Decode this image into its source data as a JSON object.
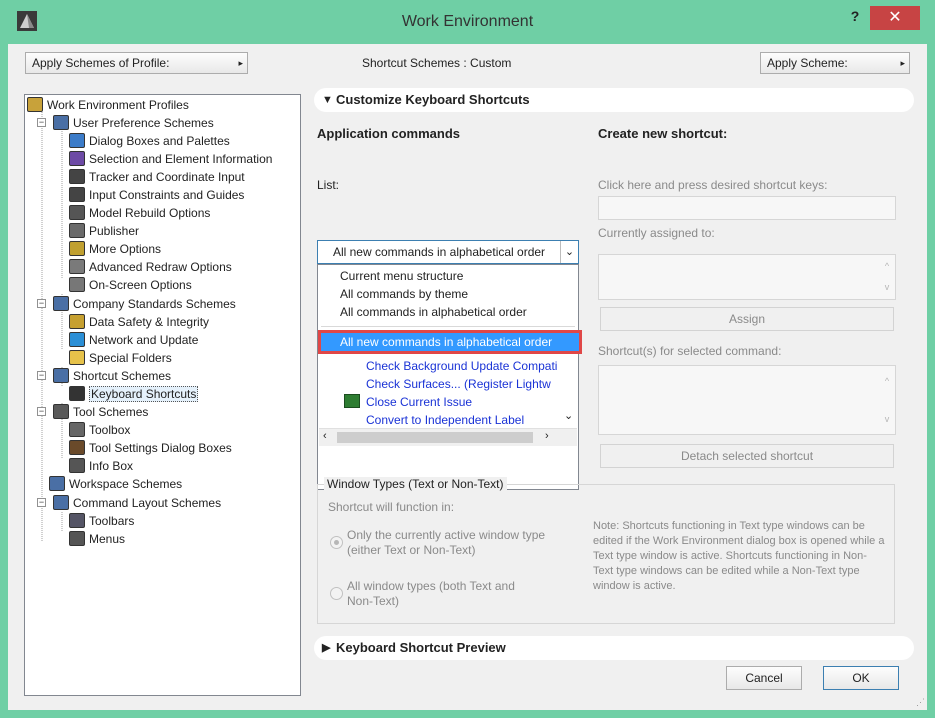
{
  "window": {
    "title": "Work Environment",
    "help_label": "?",
    "close_label": "✕"
  },
  "top": {
    "apply_profile_label": "Apply Schemes of Profile:",
    "shortcut_schemes_label": "Shortcut Schemes : Custom",
    "apply_scheme_label": "Apply Scheme:",
    "arrow": "▸"
  },
  "tree": [
    {
      "label": "Work Environment Profiles",
      "icon": "profiles-icon"
    },
    {
      "label": "User Preference Schemes",
      "icon": "user-prefs-icon"
    },
    {
      "label": "Dialog Boxes and Palettes",
      "icon": "dialog-icon"
    },
    {
      "label": "Selection and Element Information",
      "icon": "selection-icon"
    },
    {
      "label": "Tracker and Coordinate Input",
      "icon": "tracker-icon"
    },
    {
      "label": "Input Constraints and Guides",
      "icon": "constraints-icon"
    },
    {
      "label": "Model Rebuild Options",
      "icon": "rebuild-icon"
    },
    {
      "label": "Publisher",
      "icon": "publisher-icon"
    },
    {
      "label": "More Options",
      "icon": "options-icon"
    },
    {
      "label": "Advanced Redraw Options",
      "icon": "redraw-icon"
    },
    {
      "label": "On-Screen Options",
      "icon": "onscreen-icon"
    },
    {
      "label": "Company Standards Schemes",
      "icon": "company-icon"
    },
    {
      "label": "Data Safety & Integrity",
      "icon": "safety-icon"
    },
    {
      "label": "Network and Update",
      "icon": "network-icon"
    },
    {
      "label": "Special Folders",
      "icon": "folder-icon"
    },
    {
      "label": "Shortcut Schemes",
      "icon": "shortcut-schemes-icon"
    },
    {
      "label": "Keyboard Shortcuts",
      "icon": "keyboard-icon"
    },
    {
      "label": "Tool Schemes",
      "icon": "tool-schemes-icon"
    },
    {
      "label": "Toolbox",
      "icon": "toolbox-icon"
    },
    {
      "label": "Tool Settings Dialog Boxes",
      "icon": "tool-settings-icon"
    },
    {
      "label": "Info Box",
      "icon": "infobox-icon"
    },
    {
      "label": "Workspace Schemes",
      "icon": "workspace-icon"
    },
    {
      "label": "Command Layout Schemes",
      "icon": "command-layout-icon"
    },
    {
      "label": "Toolbars",
      "icon": "toolbars-icon"
    },
    {
      "label": "Menus",
      "icon": "menus-icon"
    }
  ],
  "customize": {
    "header": "Customize Keyboard Shortcuts",
    "app_commands": "Application commands",
    "list_label": "List:",
    "combo_value": "All new commands in alphabetical order",
    "combo_arrow": "⌄",
    "dropdown_options": [
      "Current menu structure",
      "All commands by theme",
      "All commands in alphabetical order",
      "All new commands in alphabetical order"
    ],
    "commands": [
      "Check Background Update Compati",
      "Check Surfaces... (Register Lightw",
      "Close Current Issue",
      "Convert to Independent Label"
    ],
    "create_new": "Create new shortcut:",
    "press_keys": "Click here and press desired shortcut keys:",
    "currently_assigned": "Currently assigned to:",
    "assign": "Assign",
    "shortcuts_for": "Shortcut(s) for selected command:",
    "detach": "Detach selected shortcut"
  },
  "window_types": {
    "title": "Window Types (Text or Non-Text)",
    "function_in": "Shortcut will function in:",
    "opt1_line1": "Only the currently active window type",
    "opt1_line2": "(either Text or Non-Text)",
    "opt2_line1": "All window types (both Text and",
    "opt2_line2": "Non-Text)",
    "note": "Note: Shortcuts functioning in Text type windows can be edited if the Work Environment dialog box is opened while a Text type window is active. Shortcuts functioning in Non-Text type windows can be edited while a Non-Text type window is active."
  },
  "preview": {
    "header": "Keyboard Shortcut Preview"
  },
  "footer": {
    "cancel": "Cancel",
    "ok": "OK"
  },
  "colors": {
    "title_bar": "#6fcfa5",
    "close": "#c74444",
    "selection": "#3399ff",
    "highlight_outline": "#e04747",
    "link": "#1a33d6"
  }
}
